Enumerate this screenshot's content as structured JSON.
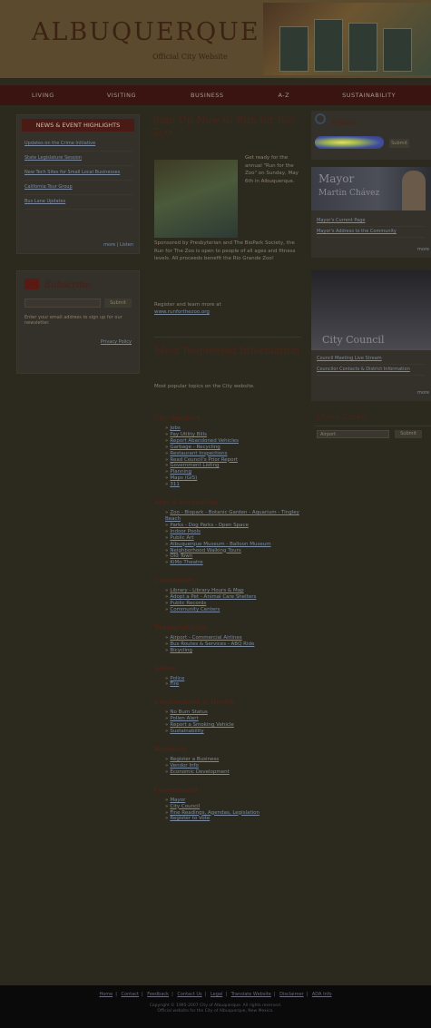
{
  "header": {
    "logo_text": "ALBUQUERQUE",
    "logo_subtitle": "Official City Website"
  },
  "nav": {
    "items": [
      "LIVING",
      "VISITING",
      "BUSINESS",
      "A-Z",
      "SUSTAINABILITY"
    ]
  },
  "news": {
    "title": "NEWS & EVENT HIGHLIGHTS",
    "items": [
      "Updates on the Crime Initiative",
      "State Legislature Session",
      "New Tech Sites for Small Local Businesses",
      "California Tour Group",
      "Bus Lane Updates"
    ],
    "more": "more",
    "listen": "Listen"
  },
  "subscribe": {
    "title": "Subscribe",
    "button": "Submit",
    "text": "Enter your email address to sign up for our newsletter.",
    "privacy": "Privacy Policy"
  },
  "feature": {
    "title": "Sign Up Now to Run for the Zoo",
    "side_text": "Get ready for the annual \"Run for the Zoo\" on Sunday, May 6th in Albuquerque.",
    "body_text": "Sponsored by Presbyterian and The BioPark Society, the Run for The Zoo is open to people of all ages and fitness levels. All proceeds benefit the Rio Grande Zoo!",
    "register_text": "Register and learn more at",
    "register_link": "www.runforthezoo.org"
  },
  "most_requested": {
    "title": "Most Requested Information",
    "description": "Most popular topics on the City website.",
    "sections": [
      {
        "title": "City Services",
        "links": [
          "Jobs",
          "Pay Utility Bills",
          "Report Abandoned Vehicles",
          "Garbage - Recycling",
          "Restaurant Inspections",
          "Read Council's Prior Report",
          "Government Listing",
          "Planning",
          "Maps (GIS)",
          "311"
        ]
      },
      {
        "title": "Arts & Recreation",
        "links": [
          "Zoo - Biopark - Botanic Garden - Aquarium - Tingley Beach",
          "Parks - Dog Parks - Open Space",
          "Indoor Pools",
          "Public Art",
          "Albuquerque Museum - Balloon Museum",
          "Neighborhood Walking Tours",
          "Old Town",
          "KiMo Theatre"
        ]
      },
      {
        "title": "Community",
        "links": [
          "Library - Library Hours & Map",
          "Adopt a Pet - Animal Care Shelters",
          "Public Records",
          "Community Centers"
        ]
      },
      {
        "title": "Transportation",
        "links": [
          "Airport - Commercial Airlines",
          "Bus Routes & Services - ABQ Ride",
          "Bicycling"
        ]
      },
      {
        "title": "Safety",
        "links": [
          "Police",
          "Fire"
        ]
      },
      {
        "title": "Environment & Health",
        "links": [
          "No Burn Status",
          "Pollen Alert",
          "Report a Smoking Vehicle",
          "Sustainability"
        ]
      },
      {
        "title": "Business",
        "links": [
          "Register a Business",
          "Vendor Info",
          "Economic Development"
        ]
      },
      {
        "title": "Government",
        "links": [
          "Mayor",
          "City Council",
          "Fine Readings, Agendas, Legislation",
          "Register to Vote"
        ]
      }
    ]
  },
  "search": {
    "label": "Search",
    "button": "Submit"
  },
  "mayor": {
    "title": "Mayor",
    "name": "Martin Chávez",
    "links": [
      "Mayor's Current Page",
      "Mayor's Address to the Community"
    ],
    "more": "more"
  },
  "council": {
    "title": "City Council",
    "links": [
      "Council Meeting Live Stream",
      "Councilor Contacts & District Information"
    ],
    "more": "more"
  },
  "quick_links": {
    "title": "Quick Links!",
    "selected": "Airport",
    "button": "Submit"
  },
  "footer": {
    "links": [
      "Home",
      "Contact",
      "Feedback",
      "Contact Us",
      "Legal",
      "Translate Website",
      "Disclaimer",
      "ADA Info"
    ],
    "copyright": "Copyright © 1995-2007 City of Albuquerque. All rights reserved.",
    "copyright2": "Official website for the City of Albuquerque, New Mexico."
  }
}
